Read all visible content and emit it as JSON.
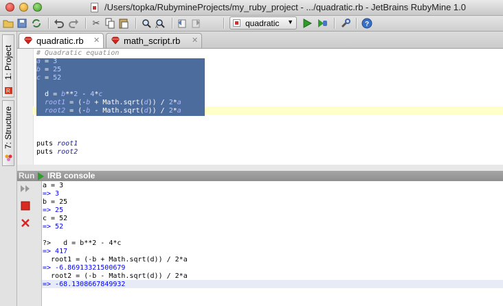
{
  "window": {
    "title": "/Users/topka/RubymineProjects/my_ruby_project - .../quadratic.rb - JetBrains RubyMine 1.0"
  },
  "toolbar": {
    "run_config": "quadratic",
    "icons": [
      "open-folder",
      "save-all",
      "sync",
      "undo",
      "redo",
      "cut",
      "copy",
      "paste",
      "find",
      "find-replace",
      "back",
      "forward",
      "run",
      "debug",
      "settings",
      "help"
    ]
  },
  "sidebar": {
    "project_tab": "1: Project",
    "structure_tab": "7: Structure"
  },
  "tabs": [
    {
      "label": "quadratic.rb",
      "active": true
    },
    {
      "label": "math_script.rb",
      "active": false
    }
  ],
  "editor": {
    "comment": "# Quadratic equation",
    "a_name": "a",
    "a_op": " = ",
    "a_val": "3",
    "b_name": "b",
    "b_op": " = ",
    "b_val": "25",
    "c_name": "c",
    "c_op": " = ",
    "c_val": "52",
    "d_prefix": "  d = ",
    "d_b": "b",
    "d_pow": "**",
    "d_two": "2",
    "d_minus": " - ",
    "d_four": "4",
    "d_star": "*",
    "d_c": "c",
    "r1_name": "  root1",
    "r1_mid": " = (-",
    "r1_b": "b",
    "r1_sqrt": " + Math.sqrt(",
    "r1_d": "d",
    "r1_div": ")) / ",
    "r1_two": "2",
    "r1_star": "*",
    "r1_a": "a",
    "r2_name": "  root2",
    "r2_mid": " = (-",
    "r2_b": "b",
    "r2_sqrt": " - Math.sqrt(",
    "r2_d": "d",
    "r2_div": ")) / ",
    "r2_two": "2",
    "r2_star": "*",
    "r2_a": "a",
    "puts1_kw": "puts ",
    "puts1_var": "root1",
    "puts2_kw": "puts ",
    "puts2_var": "root2"
  },
  "run_panel": {
    "run_label": "Run",
    "console_title": "IRB console"
  },
  "console": {
    "lines": [
      "a = 3",
      "=> 3",
      "b = 25",
      "=> 25",
      "c = 52",
      "=> 52",
      "",
      "?>   d = b**2 - 4*c",
      "=> 417",
      "  root1 = (-b + Math.sqrt(d)) / 2*a",
      "=> -6.86913321500679",
      "  root2 = (-b - Math.sqrt(d)) / 2*a",
      "=> -68.1308667849932"
    ]
  }
}
